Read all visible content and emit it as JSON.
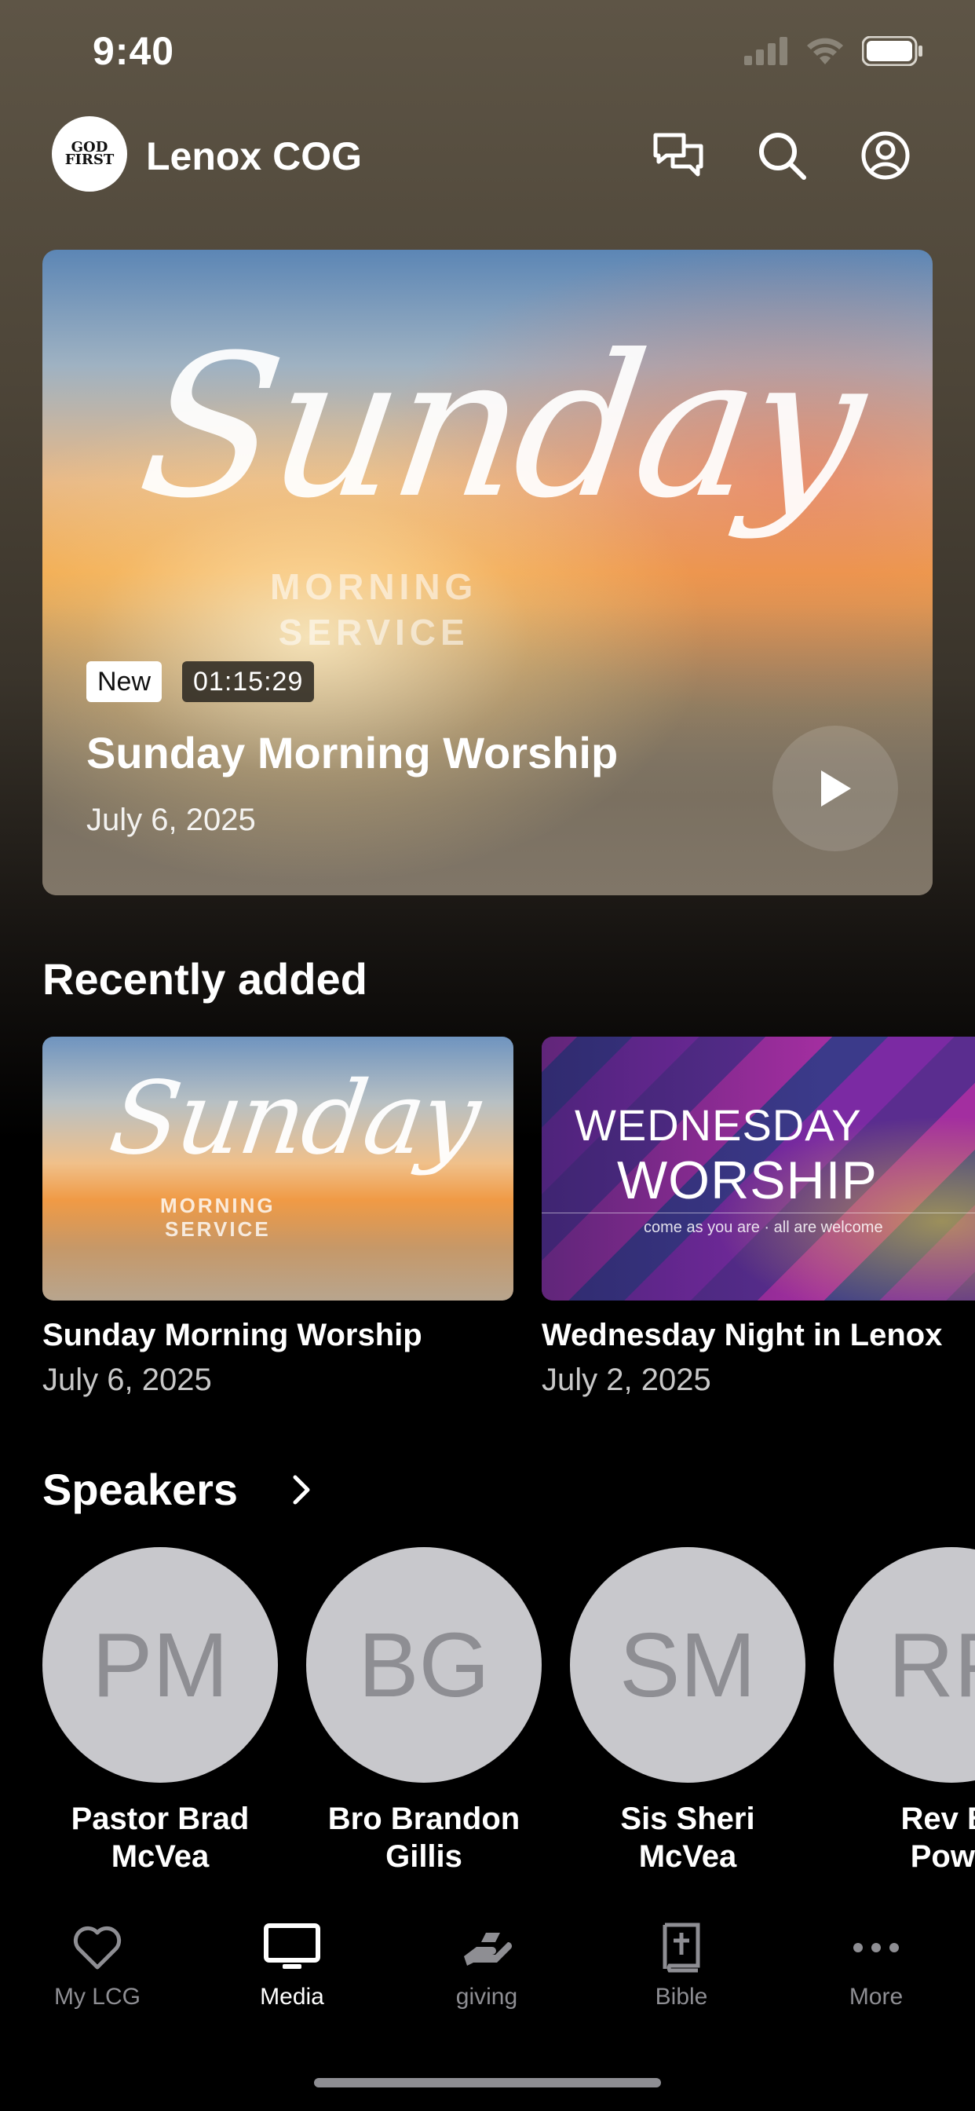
{
  "status_bar": {
    "time": "9:40"
  },
  "header": {
    "logo_text": "GOD FIRST",
    "church_name": "Lenox COG",
    "icons": [
      "chat-icon",
      "search-icon",
      "profile-icon"
    ]
  },
  "hero": {
    "art_script": "Sunday",
    "art_sub_line1": "MORNING",
    "art_sub_line2": "SERVICE",
    "badge": "New",
    "duration": "01:15:29",
    "title": "Sunday Morning Worship",
    "date": "July 6, 2025"
  },
  "recently_added": {
    "title": "Recently added",
    "items": [
      {
        "art_script": "Sunday",
        "art_sub_line1": "MORNING",
        "art_sub_line2": "SERVICE",
        "title": "Sunday Morning Worship",
        "date": "July 6, 2025"
      },
      {
        "art_line1": "WEDNESDAY",
        "art_line2": "WORSHIP",
        "art_line3": "come as you are · all are welcome",
        "title": "Wednesday Night in Lenox",
        "date": "July 2, 2025"
      }
    ]
  },
  "speakers": {
    "title": "Speakers",
    "items": [
      {
        "initials": "PM",
        "name_line1": "Pastor Brad",
        "name_line2": "McVea"
      },
      {
        "initials": "BG",
        "name_line1": "Bro Brandon",
        "name_line2": "Gillis"
      },
      {
        "initials": "SM",
        "name_line1": "Sis Sheri",
        "name_line2": "McVea"
      },
      {
        "initials": "RP",
        "name_line1": "Rev Br",
        "name_line2": "Powe"
      }
    ]
  },
  "tab_bar": {
    "active": "Media",
    "items": [
      {
        "label": "My LCG",
        "icon": "heart-icon"
      },
      {
        "label": "Media",
        "icon": "tv-icon"
      },
      {
        "label": "giving",
        "icon": "giving-hand-icon"
      },
      {
        "label": "Bible",
        "icon": "bible-icon"
      },
      {
        "label": "More",
        "icon": "more-dots-icon"
      }
    ]
  },
  "colors": {
    "background": "#000000",
    "avatar_bg": "#c8c8cc",
    "inactive_tab": "#8e8e93",
    "active_tab": "#ffffff"
  }
}
